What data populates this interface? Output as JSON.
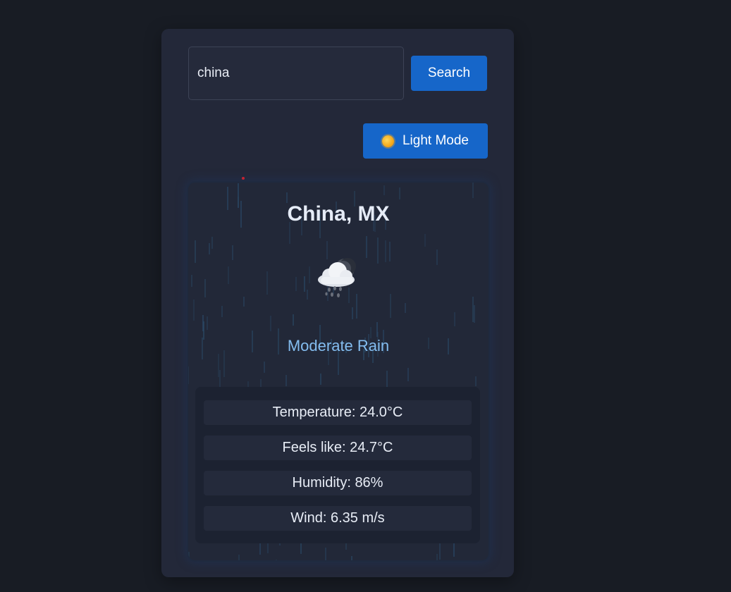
{
  "search": {
    "value": "china",
    "placeholder": "",
    "button_label": "Search"
  },
  "theme_toggle": {
    "label": "Light Mode",
    "icon": "sun-icon"
  },
  "weather": {
    "city": "China, MX",
    "icon": "cloud-moon-rain-icon",
    "condition": "Moderate Rain",
    "details": [
      "Temperature: 24.0°C",
      "Feels like: 24.7°C",
      "Humidity: 86%",
      "Wind: 6.35 m/s"
    ]
  },
  "colors": {
    "page_background": "#181c24",
    "panel_background": "#232839",
    "accent": "#1666c9",
    "condition_text": "#84bdf0",
    "rain": "#2b4a68"
  }
}
